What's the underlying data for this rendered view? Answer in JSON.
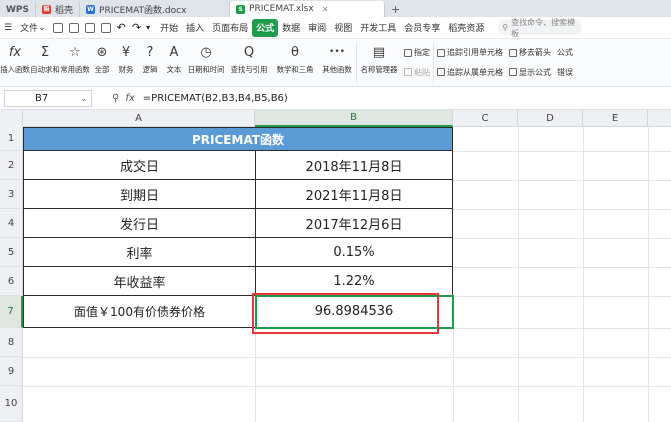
{
  "tabs": [
    {
      "icon": "wps-logo-icon",
      "label": "WPS",
      "color": "#d6d9df"
    },
    {
      "icon": "daoke-icon",
      "label": "稻壳",
      "color": "#e03b2f"
    },
    {
      "icon": "word-doc-icon",
      "label": "PRICEMAT函数.docx",
      "color": "#2b6fd6"
    },
    {
      "icon": "excel-sheet-icon",
      "label": "PRICEMAT.xlsx",
      "color": "#1f9b4c"
    }
  ],
  "menu": {
    "file_label": "文件",
    "items": [
      "开始",
      "插入",
      "页面布局",
      "公式",
      "数据",
      "审阅",
      "视图",
      "开发工具",
      "会员专享",
      "稻壳资源"
    ],
    "active": "公式",
    "search_placeholder": "查找命令、搜索模板"
  },
  "ribbon": {
    "buttons": [
      {
        "icon": "fx-icon",
        "glyph": "fx",
        "label": "插入函数"
      },
      {
        "icon": "sum-icon",
        "glyph": "Σ",
        "label": "自动求和"
      },
      {
        "icon": "star-icon",
        "glyph": "☆",
        "label": "常用函数"
      },
      {
        "icon": "all-functions-icon",
        "glyph": "⊛",
        "label": "全部"
      },
      {
        "icon": "finance-icon",
        "glyph": "¥",
        "label": "财务"
      },
      {
        "icon": "logic-icon",
        "glyph": "?",
        "label": "逻辑"
      },
      {
        "icon": "text-icon",
        "glyph": "A",
        "label": "文本"
      },
      {
        "icon": "datetime-icon",
        "glyph": "◷",
        "label": "日期和时间"
      },
      {
        "icon": "lookup-icon",
        "glyph": "Q",
        "label": "查找与引用"
      },
      {
        "icon": "math-icon",
        "glyph": "θ",
        "label": "数学和三角"
      },
      {
        "icon": "more-functions-icon",
        "glyph": "•••",
        "label": "其他函数"
      },
      {
        "icon": "name-manager-icon",
        "glyph": "▤",
        "label": "名称管理器"
      }
    ],
    "small_col1": [
      "指定",
      "粘贴"
    ],
    "small_col2": [
      "追踪引用单元格",
      "追踪从属单元格"
    ],
    "small_col3": [
      "移去箭头",
      "显示公式"
    ],
    "small_col4": [
      "公式",
      "错误"
    ]
  },
  "formula_bar": {
    "cell_ref": "B7",
    "fx_label": "fx",
    "formula": "=PRICEMAT(B2,B3,B4,B5,B6)"
  },
  "sheet": {
    "columns": [
      "A",
      "B",
      "C",
      "D",
      "E"
    ],
    "selected_column": "B",
    "rows": [
      "1",
      "2",
      "3",
      "4",
      "5",
      "6",
      "7",
      "8",
      "9",
      "10"
    ],
    "selected_row": "7",
    "title": "PRICEMAT函数",
    "cells": [
      {
        "label": "成交日",
        "value": "2018年11月8日"
      },
      {
        "label": "到期日",
        "value": "2021年11月8日"
      },
      {
        "label": "发行日",
        "value": "2017年12月6日"
      },
      {
        "label": "利率",
        "value": "0.15%"
      },
      {
        "label": "年收益率",
        "value": "1.22%"
      },
      {
        "label": "面值￥100有价债券价格",
        "value": "96.8984536"
      }
    ]
  },
  "colors": {
    "header_fill": "#5b9bd5",
    "active_green": "#1f9b4c",
    "highlight_red": "#e53935"
  }
}
